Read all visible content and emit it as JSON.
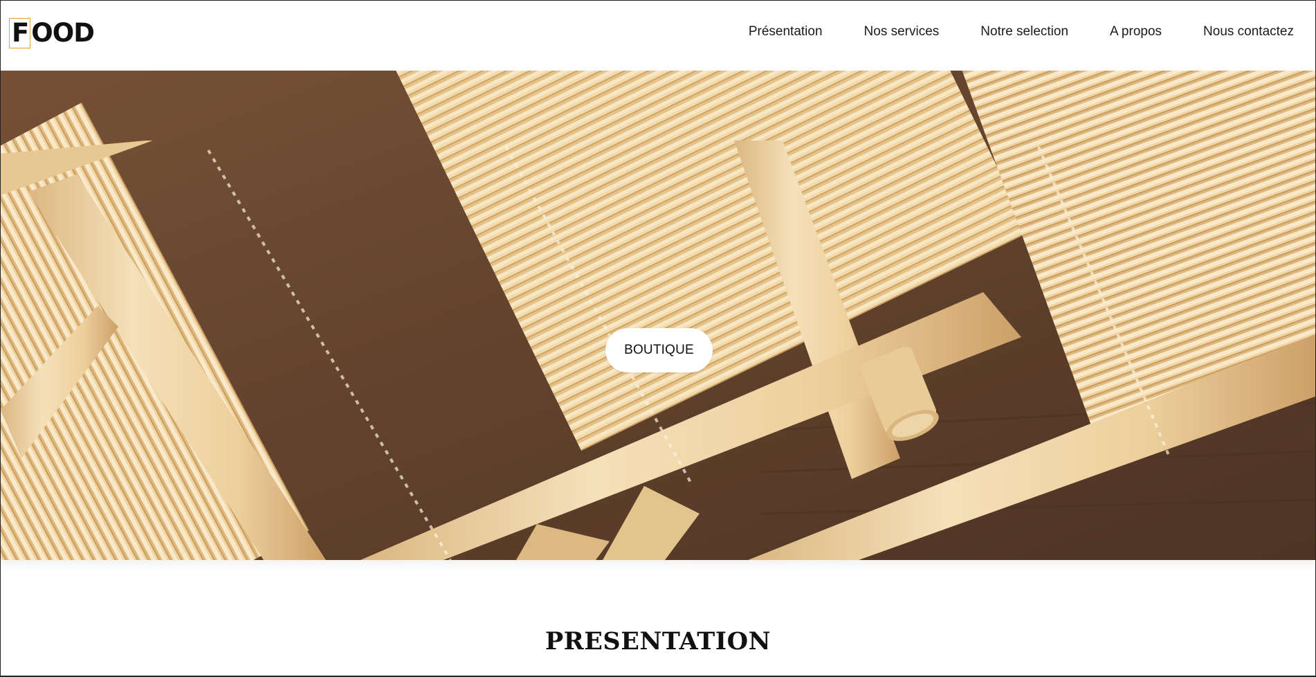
{
  "logo": {
    "first_letter": "F",
    "rest": "OOD",
    "accent_color": "#e7a927"
  },
  "nav": {
    "items": [
      {
        "label": "Présentation"
      },
      {
        "label": "Nos services"
      },
      {
        "label": "Notre selection"
      },
      {
        "label": "A propos"
      },
      {
        "label": "Nous contactez"
      }
    ]
  },
  "hero": {
    "button_label": "BOUTIQUE",
    "image_subject": "bamboo sushi mats"
  },
  "sections": {
    "presentation_title": "PRESENTATION"
  }
}
